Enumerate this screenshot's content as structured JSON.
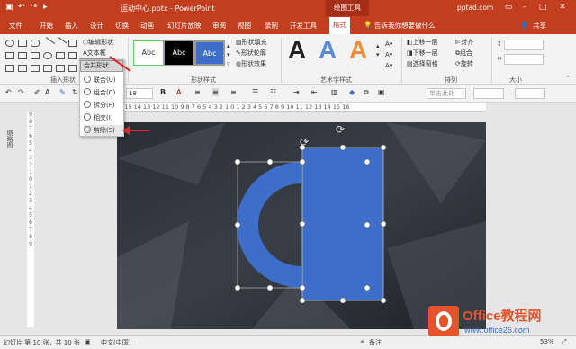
{
  "window": {
    "title": "运动中心.pptx - PowerPoint",
    "context_tab": "绘图工具",
    "account": "pptad.com",
    "colors": {
      "brand": "#c33d1f",
      "shape": "#3d6ec9",
      "arrow": "#e22222"
    }
  },
  "menu": {
    "tabs": [
      "文件",
      "开始",
      "插入",
      "设计",
      "切换",
      "动画",
      "幻灯片放映",
      "审阅",
      "视图",
      "录制",
      "开发工具",
      "格式"
    ],
    "tell_me": "告诉我你想要做什么",
    "share": "共享"
  },
  "ribbon": {
    "insert_shapes": {
      "label": "插入形状",
      "edit_shape": "编辑形状",
      "text_box": "文本框",
      "merge_shapes": "合并形状"
    },
    "shape_styles": {
      "label": "形状样式",
      "swatch": "Abc",
      "fill": "形状填充",
      "outline": "形状轮廓",
      "effects": "形状效果"
    },
    "wordart": {
      "label": "艺术字样式",
      "letter": "A"
    },
    "arrange": {
      "label": "排列",
      "bring_forward": "上移一层",
      "send_backward": "下移一层",
      "selection_pane": "选择窗格",
      "align": "对齐",
      "group": "组合",
      "rotate": "旋转"
    },
    "size": {
      "label": "大小"
    }
  },
  "format_bar": {
    "font_size": "18",
    "bold": "B",
    "font_color": "A",
    "style_placeholder": "单击此处"
  },
  "merge_menu": {
    "items": [
      "联合(U)",
      "组合(C)",
      "拆分(F)",
      "相交(I)",
      "剪除(S)"
    ]
  },
  "thumbs": {
    "label": "缩略图"
  },
  "ruler": {
    "h": "16 15 14 13 12 11 10 9 8 7 6 5 4 3 2 1 0 1 2 3 4 5 6 7 8 9 10 11 12 13 14 15 16",
    "v": "9 8 7 6 5 4 3 2 1 0 1 2 3 4 5 6 7 8 9"
  },
  "status": {
    "slide_info": "幻灯片 第 10 张，共 10 张",
    "language": "中文(中国)",
    "notes": "备注",
    "zoom": "53%"
  },
  "watermark": {
    "brand": "Office教程网",
    "url": "www.office26.com"
  }
}
